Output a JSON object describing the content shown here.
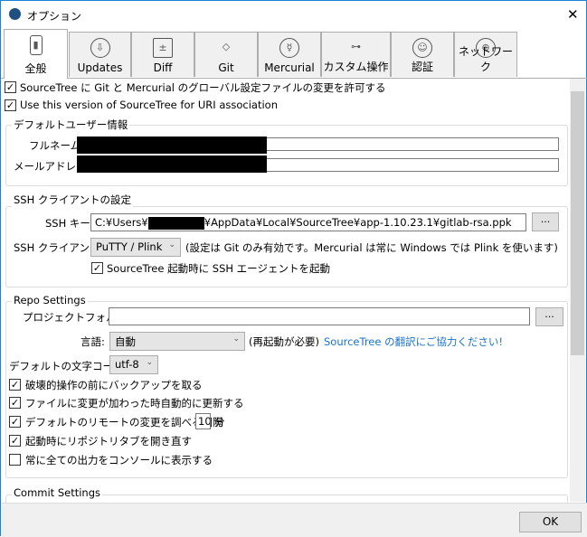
{
  "window": {
    "title": "オプション",
    "close": "✕"
  },
  "tabs": [
    {
      "label": "全般",
      "icon": "▮"
    },
    {
      "label": "Updates",
      "icon": "⇩"
    },
    {
      "label": "Diff",
      "icon": "±"
    },
    {
      "label": "Git",
      "icon": "◇"
    },
    {
      "label": "Mercurial",
      "icon": "☿"
    },
    {
      "label": "カスタム操作",
      "icon": "⊶"
    },
    {
      "label": "認証",
      "icon": "☺"
    },
    {
      "label": "ネットワーク",
      "icon": "⊕"
    }
  ],
  "general": {
    "allow_global": "SourceTree に Git と Mercurial のグローバル設定ファイルの変更を許可する",
    "uri_assoc": "Use this version of SourceTree for URI association"
  },
  "user": {
    "group": "デフォルトユーザー情報",
    "fullname_label": "フルネーム:",
    "email_label": "メールアドレス:"
  },
  "ssh": {
    "group": "SSH クライアントの設定",
    "key_label": "SSH キー:",
    "key_value_prefix": "C:¥Users¥",
    "key_value_suffix": "¥AppData¥Local¥SourceTree¥app-1.10.23.1¥gitlab-rsa.ppk",
    "browse": "...",
    "client_label": "SSH クライアント:",
    "client_value": "PuTTY / Plink",
    "client_note": "(設定は Git のみ有効です。Mercurial は常に Windows では Plink を使います)",
    "agent": "SourceTree 起動時に SSH エージェントを起動"
  },
  "repo": {
    "group": "Repo Settings",
    "folder_label": "プロジェクトフォルダ:",
    "folder_value": "",
    "browse": "...",
    "lang_label": "言語:",
    "lang_value": "自動",
    "lang_note": "(再起動が必要)",
    "lang_link": "SourceTree の翻訳にご協力ください!",
    "enc_label": "デフォルトの文字コード:",
    "enc_value": "utf-8",
    "backup": "破壊的操作の前にバックアップを取る",
    "auto_refresh": "ファイルに変更が加わった時自動的に更新する",
    "remote_check": "デフォルトのリモートの変更を調べる間隔",
    "remote_interval": "10",
    "remote_unit": "分",
    "reopen": "起動時にリポジトリタブを開き直す",
    "console": "常に全ての出力をコンソールに表示する"
  },
  "commit": {
    "group": "Commit Settings"
  },
  "ok": "OK",
  "colors": {
    "link": "#1a73c9"
  }
}
